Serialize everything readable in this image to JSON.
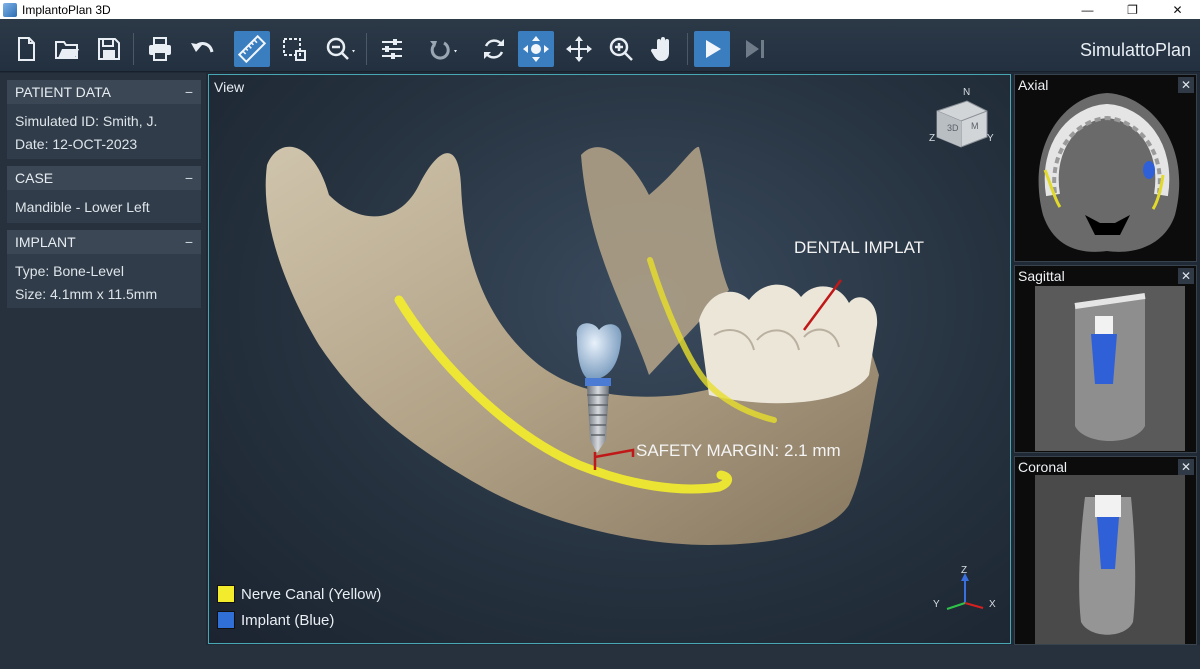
{
  "window": {
    "title": "ImplantoPlan 3D",
    "minimize": "—",
    "restore": "❐",
    "close": "✕"
  },
  "toolbar": {
    "brand": "SimulattoPlan",
    "tools": [
      "new-file",
      "open-folder",
      "save",
      "print",
      "undo",
      "measure-ruler",
      "select-region",
      "zoom-dropdown",
      "adjust-sliders",
      "rotate-dropdown",
      "refresh",
      "pan-center",
      "move",
      "zoom-in",
      "hand",
      "play",
      "step-forward"
    ],
    "active_tools": [
      "measure-ruler",
      "pan-center",
      "play"
    ]
  },
  "sidebar": {
    "patient": {
      "title": "PATIENT DATA",
      "collapse": "−",
      "id_line": "Simulated ID: Smith, J.",
      "date_line": "Date: 12-OCT-2023"
    },
    "case": {
      "title": "CASE",
      "collapse": "−",
      "line": "Mandible - Lower Left"
    },
    "implant": {
      "title": "IMPLANT",
      "collapse": "−",
      "type_line": "Type: Bone-Level",
      "size_line": "Size: 4.1mm x 11.5mm"
    }
  },
  "viewport": {
    "title": "View",
    "annotation_implant": "DENTAL IMPLAT",
    "annotation_margin": "SAFETY MARGIN: 2.1 mm",
    "cube": {
      "n": "N",
      "z": "Z",
      "y": "Y",
      "m": "M",
      "center": "3D"
    },
    "axes": {
      "z": "Z",
      "y": "Y",
      "x": "X"
    },
    "legend": [
      {
        "label": "Nerve Canal (Yellow)",
        "color": "#f2ec2c"
      },
      {
        "label": "Implant (Blue)",
        "color": "#2f6fd6"
      }
    ]
  },
  "slices": {
    "axial": {
      "label": "Axial",
      "close": "✕"
    },
    "sagittal": {
      "label": "Sagittal",
      "close": "✕"
    },
    "coronal": {
      "label": "Coronal",
      "close": "✕"
    }
  },
  "colors": {
    "accent": "#3a7ec0",
    "viewport_border": "#47a7b3",
    "nerve": "#f2ec2c",
    "implant": "#2f6fd6",
    "annotation_line": "#c01818"
  }
}
